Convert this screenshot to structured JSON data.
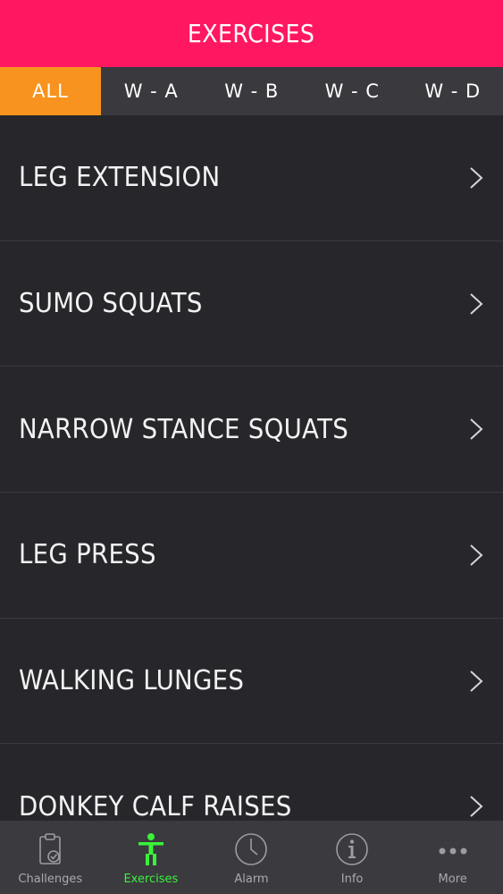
{
  "header": {
    "title": "EXERCISES"
  },
  "filter_tabs": [
    {
      "label": "ALL",
      "active": true
    },
    {
      "label": "W - A",
      "active": false
    },
    {
      "label": "W - B",
      "active": false
    },
    {
      "label": "W - C",
      "active": false
    },
    {
      "label": "W - D",
      "active": false
    }
  ],
  "exercises": [
    {
      "label": "LEG EXTENSION"
    },
    {
      "label": "SUMO SQUATS"
    },
    {
      "label": "NARROW STANCE SQUATS"
    },
    {
      "label": "LEG PRESS"
    },
    {
      "label": "WALKING LUNGES"
    },
    {
      "label": "DONKEY CALF RAISES"
    }
  ],
  "tab_bar": [
    {
      "label": "Challenges",
      "icon": "clipboard-check-icon",
      "active": false
    },
    {
      "label": "Exercises",
      "icon": "person-figure-icon",
      "active": true
    },
    {
      "label": "Alarm",
      "icon": "clock-icon",
      "active": false
    },
    {
      "label": "Info",
      "icon": "info-icon",
      "active": false
    },
    {
      "label": "More",
      "icon": "more-dots-icon",
      "active": false
    }
  ],
  "colors": {
    "header": "#ff1861",
    "active_tab": "#f7931e",
    "active_tabbar": "#3af23a",
    "background": "#26262b"
  }
}
